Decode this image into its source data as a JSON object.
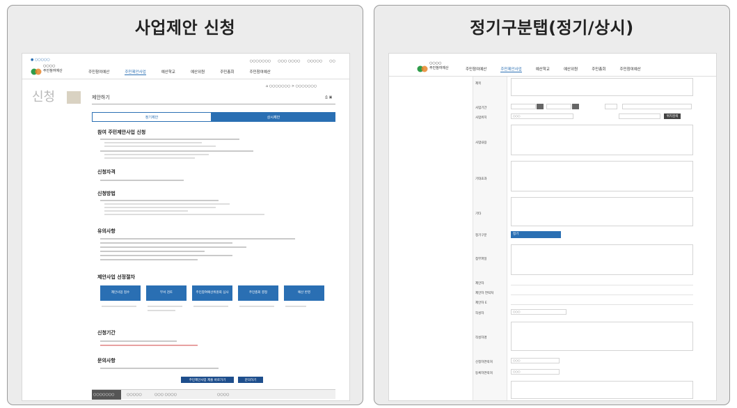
{
  "panels": [
    {
      "title": "사업제안 신청"
    },
    {
      "title": "정기구분탭(정기/상시)"
    }
  ],
  "left": {
    "top_util": [
      "○○○○○○○",
      "○○○ ○○○○",
      "○○○○○",
      "○○"
    ],
    "nav": [
      "주민참여예산",
      "주민제안사업",
      "예산학교",
      "예산위원",
      "주민총회",
      "주민참여예산"
    ],
    "page_title": "제안하기",
    "tabs": [
      "정기제안",
      "상시제안"
    ],
    "sections": [
      "참여 주민제안사업 신청",
      "신청자격",
      "신청방법",
      "유의사항",
      "제안사업 선정절차",
      "신청기간",
      "문의사항"
    ],
    "steps": [
      "제안사업 접수",
      "부서 검토",
      "주민참여예산위원회 심사",
      "주민총회 결정",
      "예산 반영"
    ],
    "buttons": [
      "주민제안사업 제출 바로가기",
      "문의하기"
    ],
    "footer": [
      "○○○○○○○",
      "○○○○○",
      "○○○ ○○○○",
      "○○○○"
    ]
  },
  "right": {
    "nav": [
      "주민참여예산",
      "주민제안사업",
      "예산학교",
      "예산위원",
      "주민총회",
      "주민참여예산"
    ],
    "labels": [
      "제목",
      "사업기간",
      "사업위치",
      "사업내용",
      "기대효과",
      "기타",
      "정기구분",
      "첨부파일",
      "",
      "제안자",
      "제안자 연락처",
      "제안자 E",
      "작성자",
      "작성자명",
      "신청자연락처",
      "등록자연락처"
    ],
    "values": {
      "search_btn": "위치검색",
      "select_value": "정기",
      "input1": "○○○",
      "input2": "○○○",
      "input3": "○○○",
      "input4": "○○○"
    }
  },
  "colors": {
    "accent": "#2a6fb3",
    "dark": "#1e4e8c",
    "logo_green": "#2e9c4a",
    "logo_orange": "#e8862c"
  }
}
